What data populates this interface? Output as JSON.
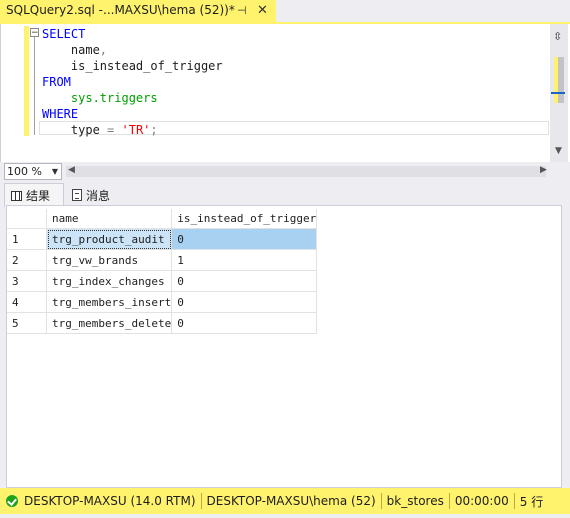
{
  "document_tab": {
    "title": "SQLQuery2.sql -...MAXSU\\hema (52))*",
    "pin_icon": "pin-icon",
    "close_icon": "close-icon"
  },
  "editor": {
    "lines": [
      {
        "parts": [
          {
            "t": "SELECT",
            "c": "kw"
          }
        ]
      },
      {
        "parts": [
          {
            "t": "    name",
            "c": ""
          },
          {
            "t": ",",
            "c": "gray"
          }
        ]
      },
      {
        "parts": [
          {
            "t": "    is_instead_of_trigger",
            "c": ""
          }
        ]
      },
      {
        "parts": [
          {
            "t": "FROM",
            "c": "kw"
          }
        ]
      },
      {
        "parts": [
          {
            "t": "    sys.triggers",
            "c": "sys"
          }
        ]
      },
      {
        "parts": [
          {
            "t": "WHERE",
            "c": "kw"
          }
        ]
      },
      {
        "parts": [
          {
            "t": "    type ",
            "c": ""
          },
          {
            "t": "=",
            "c": "gray"
          },
          {
            "t": " 'TR'",
            "c": "str"
          },
          {
            "t": ";",
            "c": "gray"
          }
        ]
      }
    ]
  },
  "zoom": {
    "value": "100 %"
  },
  "result_tabs": [
    {
      "label": "结果",
      "icon": "grid-icon"
    },
    {
      "label": "消息",
      "icon": "message-icon"
    }
  ],
  "results": {
    "columns": [
      "name",
      "is_instead_of_trigger"
    ],
    "rows": [
      {
        "num": "1",
        "name": "trg_product_audit",
        "val": "0"
      },
      {
        "num": "2",
        "name": "trg_vw_brands",
        "val": "1"
      },
      {
        "num": "3",
        "name": "trg_index_changes",
        "val": "0"
      },
      {
        "num": "4",
        "name": "trg_members_insert",
        "val": "0"
      },
      {
        "num": "5",
        "name": "trg_members_delete",
        "val": "0"
      }
    ]
  },
  "status_bar": {
    "server": "DESKTOP-MAXSU (14.0 RTM)",
    "user": "DESKTOP-MAXSU\\hema (52)",
    "database": "bk_stores",
    "elapsed": "00:00:00",
    "rows": "5 行"
  },
  "colors": {
    "accent": "#fff26c",
    "keyword": "#0000ff",
    "system_object": "#00a000",
    "string": "#ff0000"
  }
}
